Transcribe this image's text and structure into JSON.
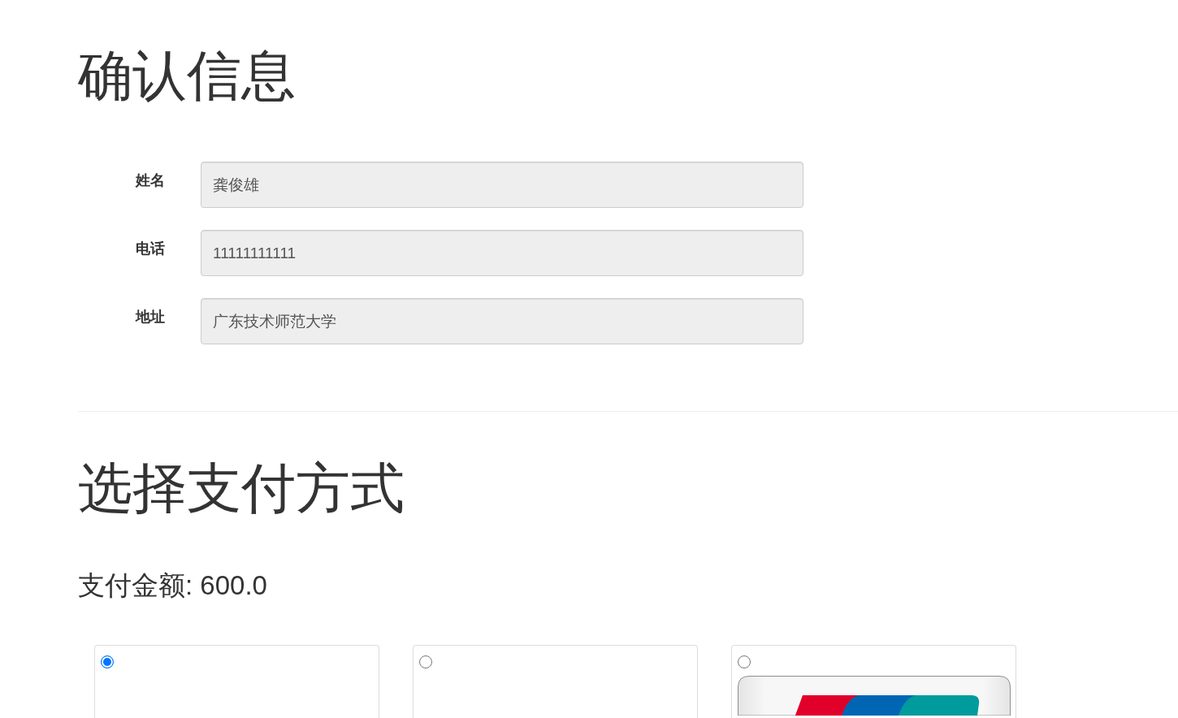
{
  "confirm_section": {
    "title": "确认信息",
    "fields": [
      {
        "label": "姓名",
        "value": "龚俊雄"
      },
      {
        "label": "电话",
        "value": "11111111111"
      },
      {
        "label": "地址",
        "value": "广东技术师范大学"
      }
    ]
  },
  "payment_section": {
    "title": "选择支付方式",
    "amount": "支付金额: 600.0",
    "methods": [
      {
        "kind": "empty",
        "selected": true
      },
      {
        "kind": "empty",
        "selected": false
      },
      {
        "kind": "logo",
        "selected": false
      }
    ]
  }
}
